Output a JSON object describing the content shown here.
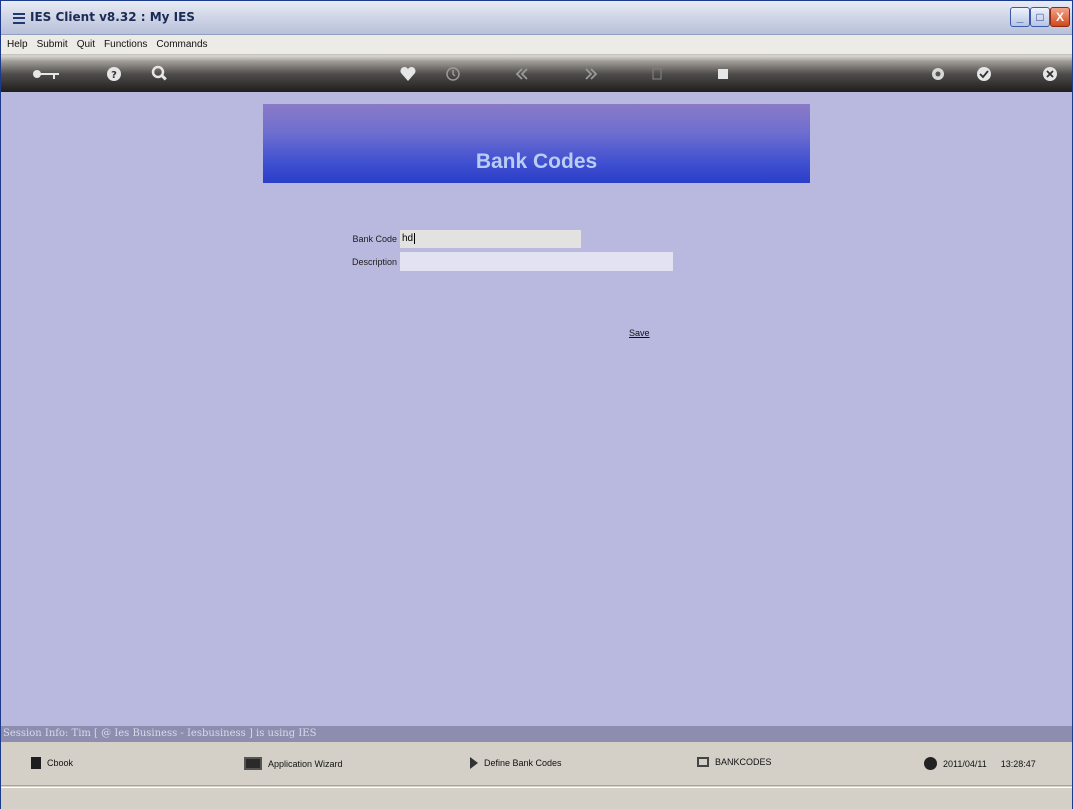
{
  "window": {
    "title": "IES Client v8.32 : My IES",
    "controls": {
      "minimize": "_",
      "maximize": "□",
      "close": "X"
    }
  },
  "menu": [
    "Help",
    "Submit",
    "Quit",
    "Functions",
    "Commands"
  ],
  "toolbar": {
    "icons": [
      "key-icon",
      "help-icon",
      "search-icon",
      "heart-icon",
      "clock-icon",
      "rewind-icon",
      "forward-icon",
      "copy-icon",
      "stop-icon",
      "gear-icon",
      "check-icon",
      "close-icon"
    ]
  },
  "form": {
    "title": "Bank Codes",
    "bank_code_label": "Bank Code",
    "bank_code_value": "hd",
    "description_label": "Description",
    "description_value": "",
    "save_label": "Save"
  },
  "session": {
    "info": "Session Info: Tim [ @ Ies Business   - Iesbusiness ] is using IES"
  },
  "statusbar": {
    "cbook": "Cbook",
    "wizard": "Application Wizard",
    "define": "Define Bank Codes",
    "codes": "BANKCODES",
    "date": "2011/04/11",
    "time": "13:28:47"
  }
}
